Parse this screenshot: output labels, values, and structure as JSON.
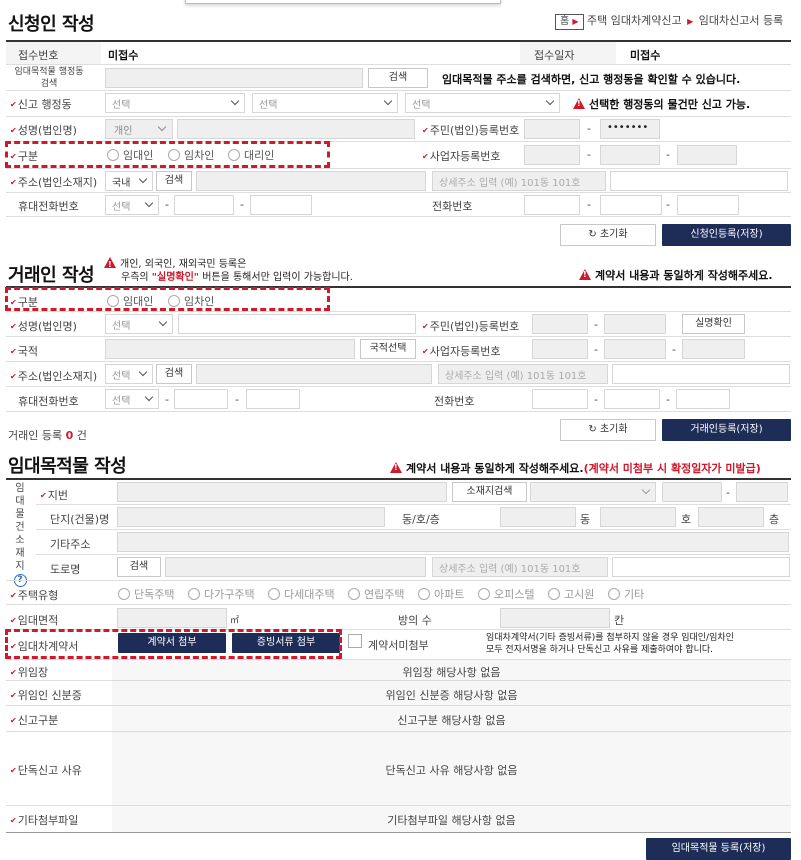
{
  "breadcrumb": {
    "home": "홈",
    "items": [
      "주택 임대차계약신고",
      "임대차신고서 등록"
    ]
  },
  "applicant": {
    "title": "신청인 작성",
    "receipt_no_label": "접수번호",
    "receipt_no": "미접수",
    "receipt_date_label": "접수일자",
    "receipt_date": "미접수",
    "address_search_label": "임대목적물 행정동 검색",
    "search_btn": "검색",
    "address_search_note": "임대목적물 주소를 검색하면, 신고 행정동을 확인할 수 있습니다.",
    "admin_dong_label": "신고 행정동",
    "select_placeholder": "선택",
    "admin_dong_warn": "선택한 행정동의 물건만 신고 가능.",
    "name_label": "성명(법인명)",
    "name_type": "개인",
    "reg_no_label": "주민(법인)등록번호",
    "reg_no_back": "•••••••",
    "category_label": "구분",
    "category_options": [
      "임대인",
      "임차인",
      "대리인"
    ],
    "biz_no_label": "사업자등록번호",
    "addr_label": "주소(법인소재지)",
    "country": "국내",
    "addr_search": "검색",
    "addr_detail_placeholder": "상세주소 입력 (예) 101동 101호",
    "mobile_label": "휴대전화번호",
    "phone_label": "전화번호",
    "reset_btn": "초기화",
    "save_btn": "신청인등록(저장)"
  },
  "counterparty": {
    "title": "거래인 작성",
    "notice_line1": "개인, 외국인, 재외국민 등록은",
    "notice_line2_pre": "우측의 ",
    "notice_line2_hl": "\"실명확인\"",
    "notice_line2_post": " 버튼을 통해서만 입력이 가능합니다.",
    "right_warn": "계약서 내용과 동일하게 작성해주세요.",
    "category_label": "구분",
    "category_options": [
      "임대인",
      "임차인"
    ],
    "name_label": "성명(법인명)",
    "select_placeholder": "선택",
    "reg_no_label": "주민(법인)등록번호",
    "verify_btn": "실명확인",
    "nationality_label": "국적",
    "nationality_btn": "국적선택",
    "biz_no_label": "사업자등록번호",
    "addr_label": "주소(법인소재지)",
    "addr_search": "검색",
    "addr_detail_placeholder": "상세주소 입력 (예) 101동 101호",
    "mobile_label": "휴대전화번호",
    "phone_label": "전화번호",
    "count_pre": "거래인 등록",
    "count": "0",
    "count_post": "건",
    "reset_btn": "초기화",
    "save_btn": "거래인등록(저장)"
  },
  "property": {
    "title": "임대목적물 작성",
    "warn_text": "계약서 내용과 동일하게 작성해주세요.",
    "warn_red": "(계약서 미첨부 시 확정일자가 미발급)",
    "location_label": "임대물건소재지",
    "lot_label": "지번",
    "lot_search": "소재지검색",
    "complex_label": "단지(건물)명",
    "unit_label": "동/호/층",
    "dong": "동",
    "ho": "호",
    "floor": "층",
    "other_addr_label": "기타주소",
    "road_label": "도로명",
    "road_search": "검색",
    "road_detail_placeholder": "상세주소 입력 (예) 101동 101호",
    "house_type_label": "주택유형",
    "house_types": [
      "단독주택",
      "다가구주택",
      "다세대주택",
      "연립주택",
      "아파트",
      "오피스텔",
      "고시원",
      "기타"
    ],
    "area_label": "임대면적",
    "area_unit": "㎡",
    "rooms_label": "방의 수",
    "rooms_unit": "칸",
    "contract_label": "임대차계약서",
    "attach_contract": "계약서 첨부",
    "attach_evidence": "증빙서류 첨부",
    "no_contract": "계약서미첨부",
    "contract_note1": "임대차계약서(기타 증빙서류)를 첨부하지 않을 경우 임대인/임차인",
    "contract_note2": "모두 전자서명을 하거나 단독신고 사유를 제출하여야 합니다.",
    "delegation_label": "위임장",
    "delegation_value": "위임장 해당사항 없음",
    "delegator_id_label": "위임인 신분증",
    "delegator_id_value": "위임인 신분증 해당사항 없음",
    "report_type_label": "신고구분",
    "report_type_value": "신고구분 해당사항 없음",
    "sole_reason_label": "단독신고 사유",
    "sole_reason_value": "단독신고 사유 해당사항 없음",
    "other_files_label": "기타첨부파일",
    "other_files_value": "기타첨부파일 해당사항 없음",
    "save_btn": "임대목적물 등록(저장)"
  }
}
